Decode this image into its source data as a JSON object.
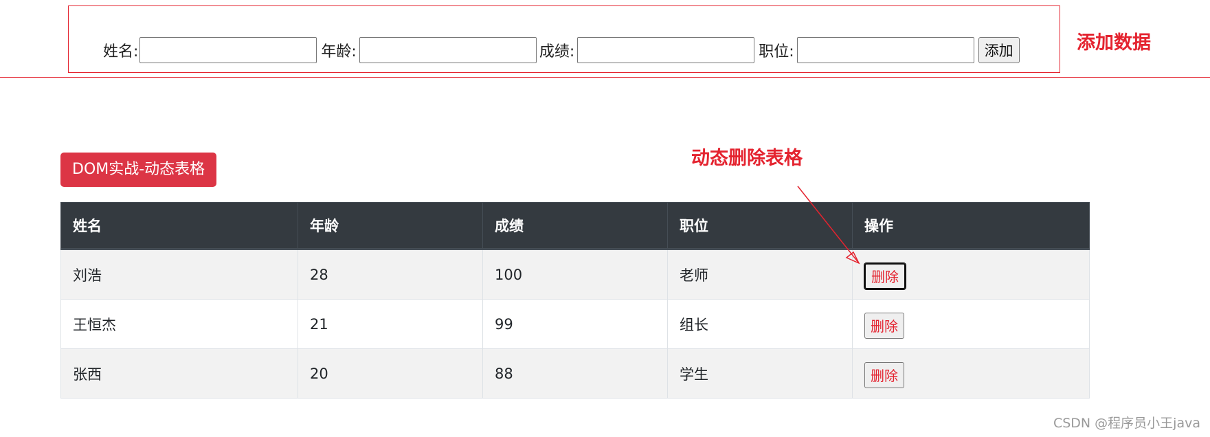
{
  "form": {
    "name_label": "姓名:",
    "age_label": "年龄:",
    "score_label": "成绩:",
    "position_label": "职位:",
    "name_value": "",
    "age_value": "",
    "score_value": "",
    "position_value": "",
    "add_button": "添加"
  },
  "annotations": {
    "add_data": "添加数据",
    "delete_row": "动态删除表格"
  },
  "title_badge": "DOM实战-动态表格",
  "table": {
    "headers": [
      "姓名",
      "年龄",
      "成绩",
      "职位",
      "操作"
    ],
    "delete_label": "删除",
    "rows": [
      {
        "name": "刘浩",
        "age": "28",
        "score": "100",
        "position": "老师"
      },
      {
        "name": "王恒杰",
        "age": "21",
        "score": "99",
        "position": "组长"
      },
      {
        "name": "张西",
        "age": "20",
        "score": "88",
        "position": "学生"
      }
    ]
  },
  "watermark": "CSDN @程序员小王java",
  "colors": {
    "annotation_red": "#e4232f",
    "badge_red": "#dc3545",
    "header_dark": "#343a40",
    "striped_row": "#f2f2f2"
  }
}
